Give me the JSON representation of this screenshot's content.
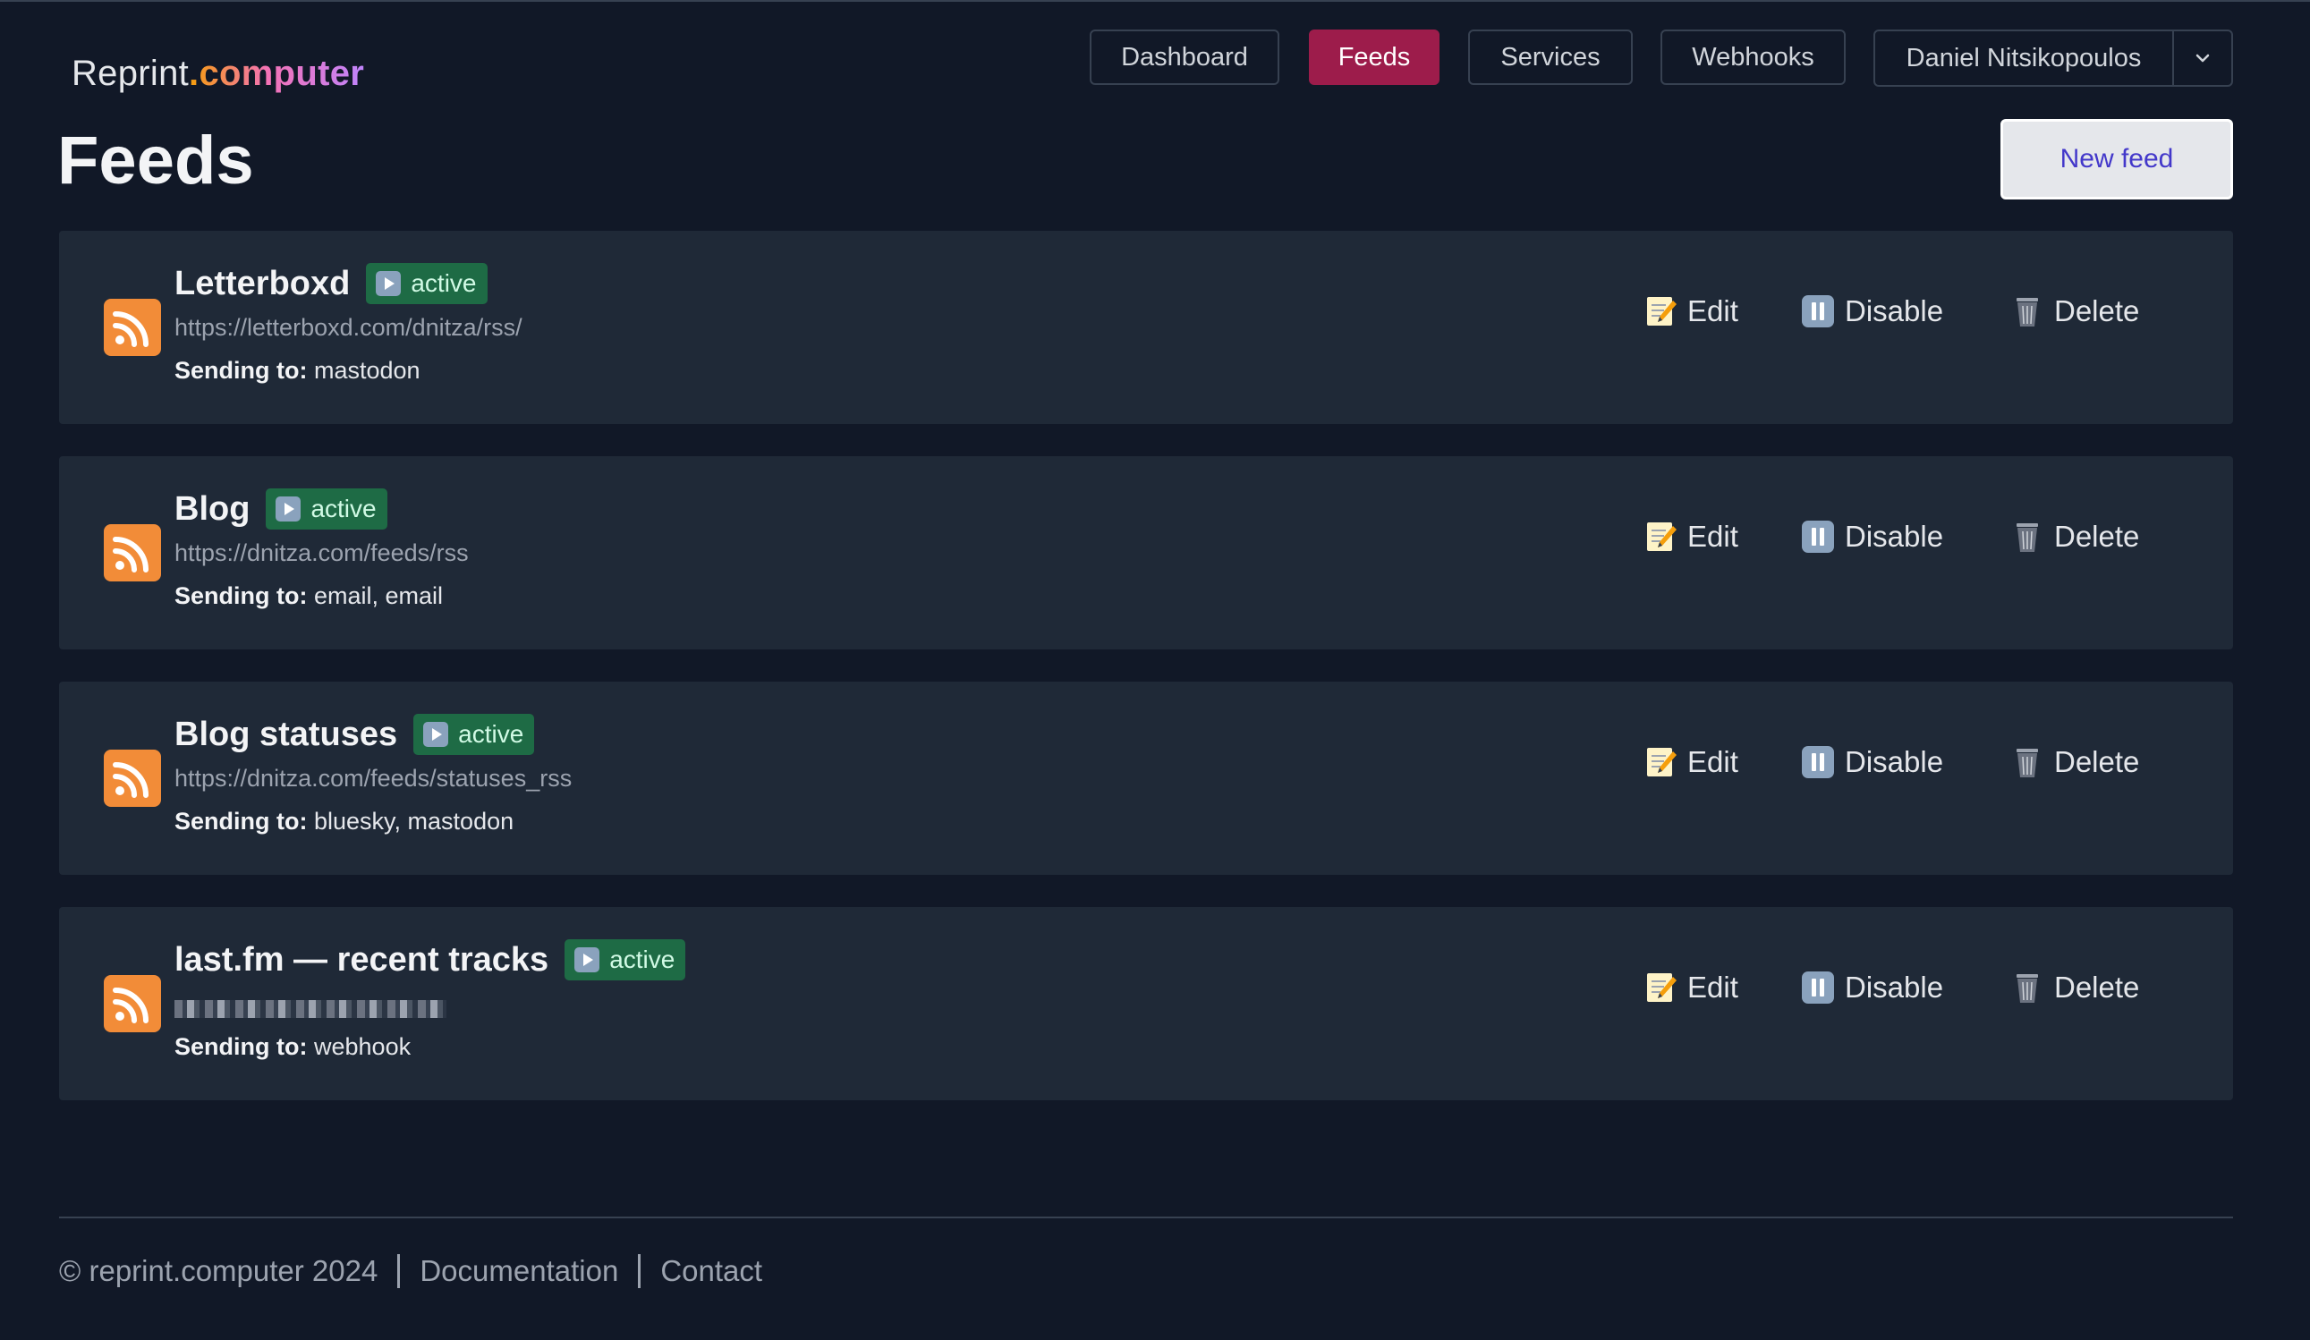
{
  "header": {
    "logo_brand": "Reprint",
    "logo_accent": ".computer",
    "nav": [
      {
        "label": "Dashboard",
        "active": false
      },
      {
        "label": "Feeds",
        "active": true
      },
      {
        "label": "Services",
        "active": false
      },
      {
        "label": "Webhooks",
        "active": false
      }
    ],
    "user_name": "Daniel Nitsikopoulos",
    "user_menu_icon": "chevron-down-icon"
  },
  "page": {
    "title": "Feeds",
    "new_feed_label": "New feed"
  },
  "feeds": [
    {
      "title": "Letterboxd",
      "status": "active",
      "url": "https://letterboxd.com/dnitza/rss/",
      "url_redacted": false,
      "sending_label": "Sending to:",
      "sending_to": "mastodon",
      "actions": {
        "edit": "Edit",
        "disable": "Disable",
        "delete": "Delete"
      }
    },
    {
      "title": "Blog",
      "status": "active",
      "url": "https://dnitza.com/feeds/rss",
      "url_redacted": false,
      "sending_label": "Sending to:",
      "sending_to": "email, email",
      "actions": {
        "edit": "Edit",
        "disable": "Disable",
        "delete": "Delete"
      }
    },
    {
      "title": "Blog statuses",
      "status": "active",
      "url": "https://dnitza.com/feeds/statuses_rss",
      "url_redacted": false,
      "sending_label": "Sending to:",
      "sending_to": "bluesky, mastodon",
      "actions": {
        "edit": "Edit",
        "disable": "Disable",
        "delete": "Delete"
      }
    },
    {
      "title": "last.fm — recent tracks",
      "status": "active",
      "url": "",
      "url_redacted": true,
      "sending_label": "Sending to:",
      "sending_to": "webhook",
      "actions": {
        "edit": "Edit",
        "disable": "Disable",
        "delete": "Delete"
      }
    }
  ],
  "footer": {
    "copyright": "© reprint.computer 2024",
    "links": [
      "Documentation",
      "Contact"
    ]
  },
  "colors": {
    "background": "#111827",
    "card": "#1f2937",
    "nav_active": "#9d1c4b",
    "badge": "#1e6b45",
    "rss_orange": "#f28c38",
    "new_feed_text": "#4338ca"
  }
}
